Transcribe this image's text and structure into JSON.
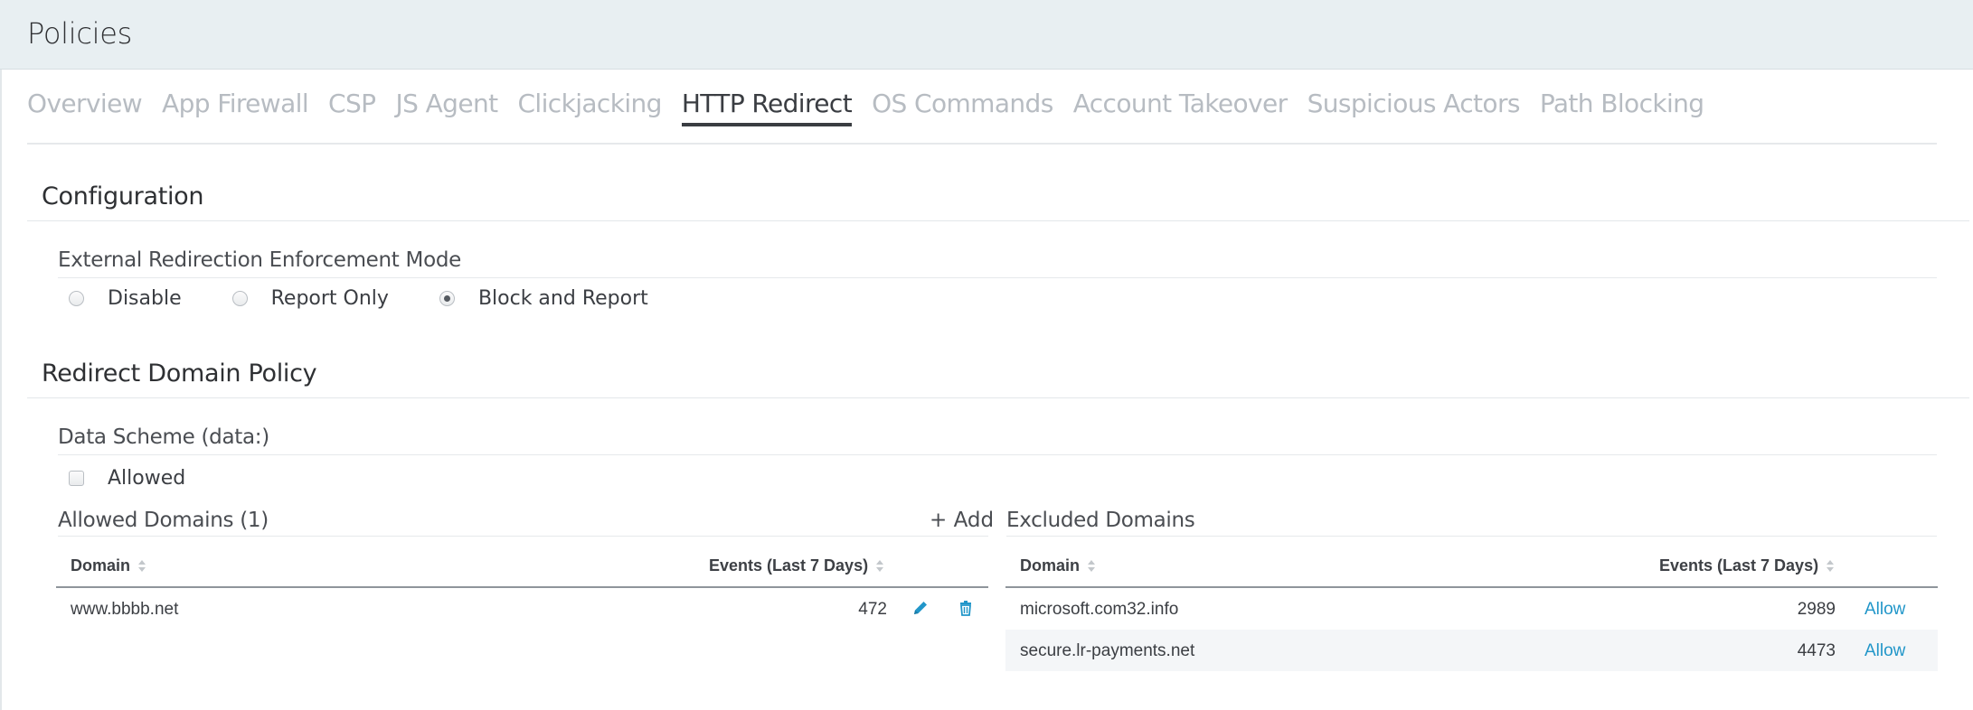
{
  "header": {
    "title": "Policies"
  },
  "tabs": [
    {
      "label": "Overview",
      "active": false
    },
    {
      "label": "App Firewall",
      "active": false
    },
    {
      "label": "CSP",
      "active": false
    },
    {
      "label": "JS Agent",
      "active": false
    },
    {
      "label": "Clickjacking",
      "active": false
    },
    {
      "label": "HTTP Redirect",
      "active": true
    },
    {
      "label": "OS Commands",
      "active": false
    },
    {
      "label": "Account Takeover",
      "active": false
    },
    {
      "label": "Suspicious Actors",
      "active": false
    },
    {
      "label": "Path Blocking",
      "active": false
    }
  ],
  "configuration": {
    "title": "Configuration",
    "mode_label": "External Redirection Enforcement Mode",
    "options": [
      {
        "label": "Disable",
        "checked": false
      },
      {
        "label": "Report Only",
        "checked": false
      },
      {
        "label": "Block and Report",
        "checked": true
      }
    ]
  },
  "redirect_policy": {
    "title": "Redirect Domain Policy",
    "data_scheme_label": "Data Scheme (data:)",
    "allowed_label": "Allowed",
    "allowed_checked": false
  },
  "allowed_domains": {
    "title": "Allowed Domains (1)",
    "add_label": "+ Add",
    "columns": [
      "Domain",
      "Events (Last 7 Days)"
    ],
    "rows": [
      {
        "domain": "www.bbbb.net",
        "events": "472"
      }
    ]
  },
  "excluded_domains": {
    "title": "Excluded Domains",
    "columns": [
      "Domain",
      "Events (Last 7 Days)"
    ],
    "rows": [
      {
        "domain": "microsoft.com32.info",
        "events": "2989",
        "action": "Allow"
      },
      {
        "domain": "secure.lr-payments.net",
        "events": "4473",
        "action": "Allow"
      }
    ]
  },
  "colors": {
    "accent": "#2196c9",
    "header_bg": "#e8eff2",
    "tab_inactive": "#b7bcc2",
    "tab_active": "#3a3d42"
  },
  "icons": {
    "edit": "pencil-icon",
    "delete": "trash-icon",
    "sort": "sort-icon"
  }
}
